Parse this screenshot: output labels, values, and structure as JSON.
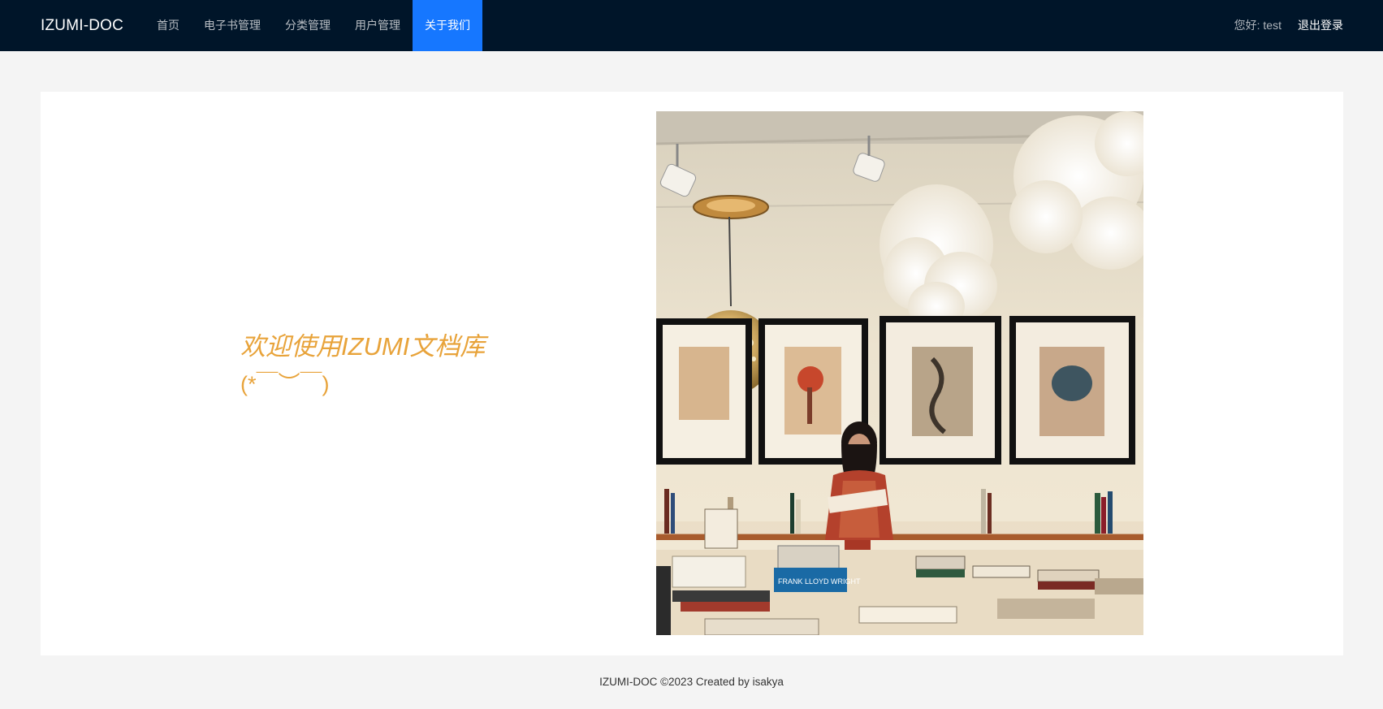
{
  "header": {
    "logo": "IZUMI-DOC",
    "nav": [
      {
        "label": "首页"
      },
      {
        "label": "电子书管理"
      },
      {
        "label": "分类管理"
      },
      {
        "label": "用户管理"
      },
      {
        "label": "关于我们",
        "active": true
      }
    ],
    "greeting": "您好: test",
    "logout": "退出登录"
  },
  "main": {
    "welcome_title": "欢迎使用IZUMI文档库",
    "welcome_face": "(*￣︶￣)"
  },
  "footer": {
    "text": "IZUMI-DOC ©2023 Created by isakya"
  },
  "colors": {
    "header_bg": "#001529",
    "active_tab": "#1677ff",
    "welcome_text": "#e8a33a"
  }
}
